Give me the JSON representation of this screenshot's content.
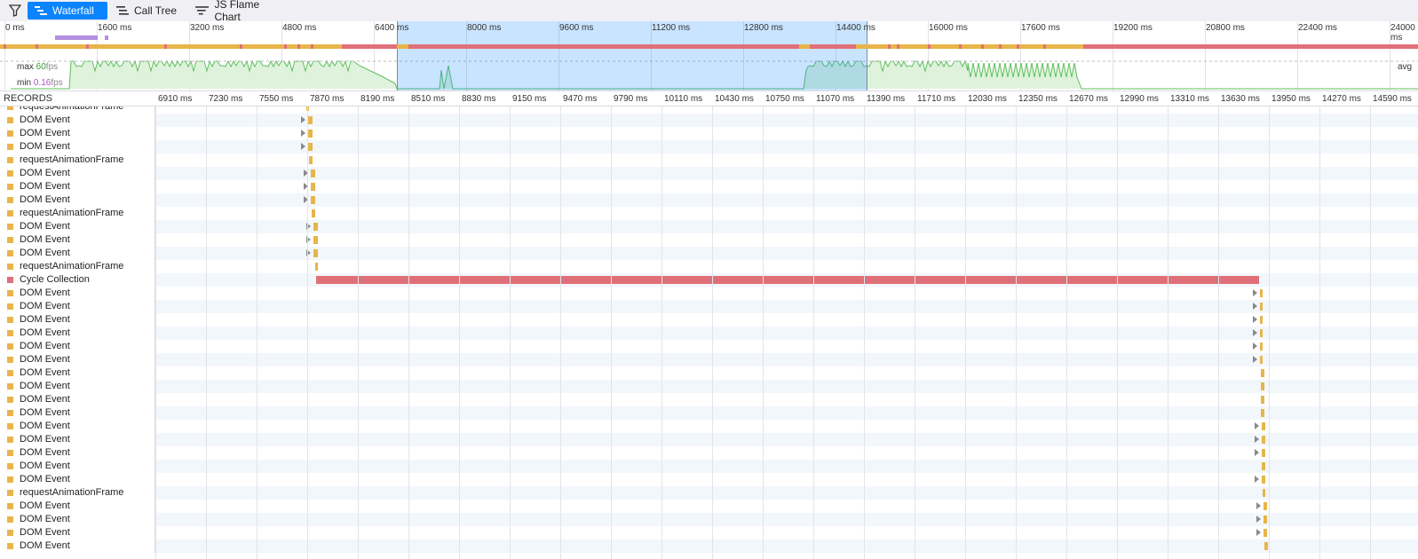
{
  "toolbar": {
    "filter_icon": "filter-icon",
    "tabs": [
      {
        "label": "Waterfall",
        "icon": "waterfall-icon",
        "active": true
      },
      {
        "label": "Call Tree",
        "icon": "call-tree-icon",
        "active": false
      },
      {
        "label": "JS Flame Chart",
        "icon": "flame-chart-icon",
        "active": false
      }
    ]
  },
  "overview": {
    "ruler": [
      "0 ms",
      "1600 ms",
      "3200 ms",
      "4800 ms",
      "6400 ms",
      "8000 ms",
      "9600 ms",
      "11200 ms",
      "12800 ms",
      "14400 ms",
      "16000 ms",
      "17600 ms",
      "19200 ms",
      "20800 ms",
      "22400 ms",
      "24000 ms"
    ],
    "fps_max_prefix": "max ",
    "fps_max_value": "60",
    "fps_min_prefix": "min ",
    "fps_min_value": "0.16",
    "fps_unit": "fps",
    "fps_avg": "avg"
  },
  "waterfall": {
    "records_header": "RECORDS",
    "ticks": [
      "6910 ms",
      "7230 ms",
      "7550 ms",
      "7870 ms",
      "8190 ms",
      "8510 ms",
      "8830 ms",
      "9150 ms",
      "9470 ms",
      "9790 ms",
      "10110 ms",
      "10430 ms",
      "10750 ms",
      "11070 ms",
      "11390 ms",
      "11710 ms",
      "12030 ms",
      "12350 ms",
      "12670 ms",
      "12990 ms",
      "13310 ms",
      "13630 ms",
      "13950 ms",
      "14270 ms",
      "14590 ms"
    ],
    "rows": [
      {
        "name": "requestAnimationFrame",
        "type": "script",
        "start": 7862,
        "dur": 20,
        "marker": false
      },
      {
        "name": "DOM Event",
        "type": "script",
        "start": 7876,
        "dur": 25,
        "marker": true
      },
      {
        "name": "DOM Event",
        "type": "script",
        "start": 7876,
        "dur": 25,
        "marker": true
      },
      {
        "name": "DOM Event",
        "type": "script",
        "start": 7876,
        "dur": 25,
        "marker": true
      },
      {
        "name": "requestAnimationFrame",
        "type": "script",
        "start": 7883,
        "dur": 20,
        "marker": false
      },
      {
        "name": "DOM Event",
        "type": "script",
        "start": 7893,
        "dur": 25,
        "marker": true
      },
      {
        "name": "DOM Event",
        "type": "script",
        "start": 7893,
        "dur": 25,
        "marker": true
      },
      {
        "name": "DOM Event",
        "type": "script",
        "start": 7893,
        "dur": 25,
        "marker": true
      },
      {
        "name": "requestAnimationFrame",
        "type": "script",
        "start": 7900,
        "dur": 20,
        "marker": false
      },
      {
        "name": "DOM Event",
        "type": "script",
        "start": 7910,
        "dur": 25,
        "marker": true
      },
      {
        "name": "DOM Event",
        "type": "script",
        "start": 7910,
        "dur": 25,
        "marker": true
      },
      {
        "name": "DOM Event",
        "type": "script",
        "start": 7910,
        "dur": 25,
        "marker": true
      },
      {
        "name": "requestAnimationFrame",
        "type": "script",
        "start": 7918,
        "dur": 20,
        "marker": false
      },
      {
        "name": "Cycle Collection",
        "type": "gc",
        "start": 7925,
        "dur": 5963,
        "marker": false
      },
      {
        "name": "DOM Event",
        "type": "script",
        "start": 13893,
        "dur": 20,
        "marker": true
      },
      {
        "name": "DOM Event",
        "type": "script",
        "start": 13893,
        "dur": 20,
        "marker": true
      },
      {
        "name": "DOM Event",
        "type": "script",
        "start": 13893,
        "dur": 20,
        "marker": true
      },
      {
        "name": "DOM Event",
        "type": "script",
        "start": 13893,
        "dur": 20,
        "marker": true
      },
      {
        "name": "DOM Event",
        "type": "script",
        "start": 13893,
        "dur": 20,
        "marker": true
      },
      {
        "name": "DOM Event",
        "type": "script",
        "start": 13893,
        "dur": 20,
        "marker": true
      },
      {
        "name": "DOM Event",
        "type": "script",
        "start": 13900,
        "dur": 20,
        "marker": false
      },
      {
        "name": "DOM Event",
        "type": "script",
        "start": 13900,
        "dur": 20,
        "marker": false
      },
      {
        "name": "DOM Event",
        "type": "script",
        "start": 13900,
        "dur": 20,
        "marker": false
      },
      {
        "name": "DOM Event",
        "type": "script",
        "start": 13900,
        "dur": 20,
        "marker": false
      },
      {
        "name": "DOM Event",
        "type": "script",
        "start": 13905,
        "dur": 20,
        "marker": true
      },
      {
        "name": "DOM Event",
        "type": "script",
        "start": 13905,
        "dur": 20,
        "marker": true
      },
      {
        "name": "DOM Event",
        "type": "script",
        "start": 13905,
        "dur": 20,
        "marker": true
      },
      {
        "name": "DOM Event",
        "type": "script",
        "start": 13905,
        "dur": 20,
        "marker": false
      },
      {
        "name": "DOM Event",
        "type": "script",
        "start": 13905,
        "dur": 20,
        "marker": true
      },
      {
        "name": "requestAnimationFrame",
        "type": "script",
        "start": 13910,
        "dur": 20,
        "marker": false
      },
      {
        "name": "DOM Event",
        "type": "script",
        "start": 13915,
        "dur": 25,
        "marker": true
      },
      {
        "name": "DOM Event",
        "type": "script",
        "start": 13915,
        "dur": 25,
        "marker": true
      },
      {
        "name": "DOM Event",
        "type": "script",
        "start": 13915,
        "dur": 25,
        "marker": true
      },
      {
        "name": "DOM Event",
        "type": "script",
        "start": 13920,
        "dur": 25,
        "marker": false
      }
    ]
  },
  "colors": {
    "script": "#e8b54a",
    "gc": "#e07078",
    "paint": "#b48ee0",
    "fps_line": "#5fbf5f",
    "fps_fill": "#dff2dc",
    "accent": "#0a84ff"
  }
}
